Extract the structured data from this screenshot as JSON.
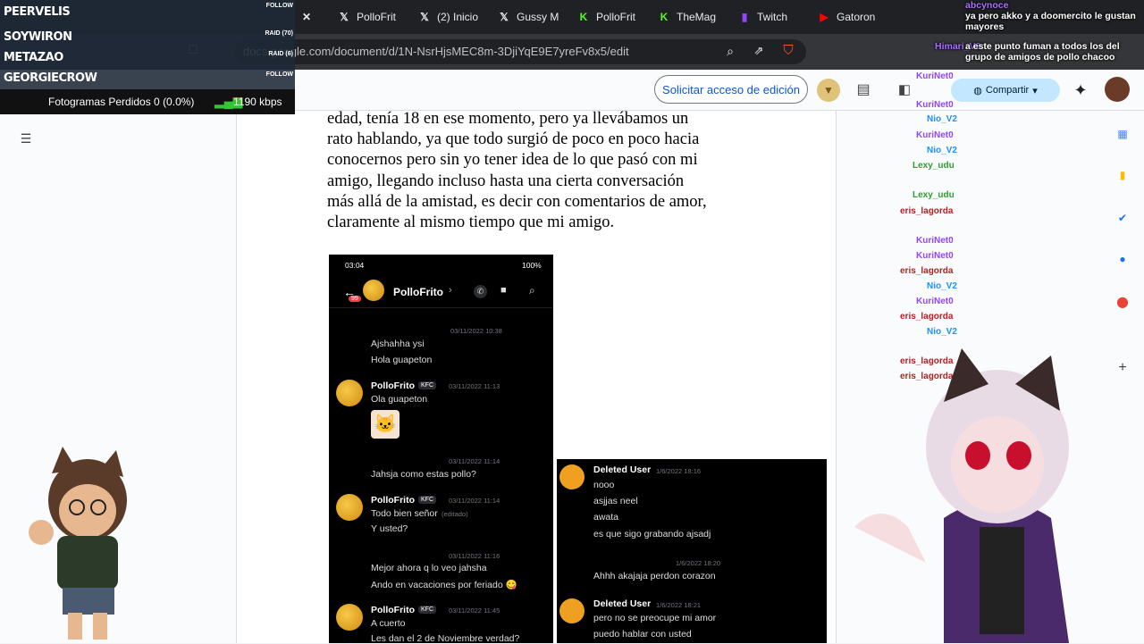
{
  "browser": {
    "tabs": [
      {
        "label": "",
        "icon": "close-icon"
      },
      {
        "label": "PolloFrit",
        "icon": "x-logo-icon"
      },
      {
        "label": "(2) Inicio",
        "icon": "x-logo-icon"
      },
      {
        "label": "Gussy M",
        "icon": "x-logo-icon"
      },
      {
        "label": "PolloFrit",
        "icon": "kick-logo-icon"
      },
      {
        "label": "TheMag",
        "icon": "kick-logo-icon"
      },
      {
        "label": "Twitch",
        "icon": "twitch-logo-icon"
      },
      {
        "label": "Gatoron",
        "icon": "youtube-logo-icon"
      }
    ],
    "url": "docs.google.com/document/d/1N-NsrHjsMEC8m-3DjiYqE9E7yreFv8x5/edit"
  },
  "docs": {
    "request_edit_label": "Solicitar acceso de edición",
    "share_label": "Compartir"
  },
  "document": {
    "paragraph_lines": [
      "edad, tenía 18 en ese momento, pero ya llevábamos un",
      "rato hablando, ya que todo surgió de poco en poco hacia",
      "conocernos pero sin yo tener idea de lo que pasó con mi",
      "amigo, llegando incluso hasta una cierta conversación",
      "más allá de la amistad, es decir con comentarios de amor,",
      "claramente al mismo tiempo que mi amigo."
    ]
  },
  "phone_screenshot": {
    "status_time": "03:04",
    "battery": "100%",
    "badge": "99",
    "contact": "PolloFrito",
    "messages": [
      {
        "ts": "03/11/2022 10:38",
        "lines": [
          "Ajshahha ysi",
          "Hola guapeton"
        ]
      },
      {
        "user": "PolloFrito",
        "tag": "KFC",
        "ts": "03/11/2022 11:13",
        "lines": [
          "Ola guapeton"
        ]
      },
      {
        "ts": "03/11/2022 11:14",
        "lines": [
          "Jahsja como estas pollo?"
        ]
      },
      {
        "user": "PolloFrito",
        "tag": "KFC",
        "ts": "03/11/2022 11:14",
        "lines": [
          "Todo bien señor",
          "Y usted?"
        ],
        "edited": "(editado)"
      },
      {
        "ts": "03/11/2022 11:16",
        "lines": [
          "Mejor ahora q lo veo jahsha",
          "Ando en vacaciones por feriado 😋"
        ]
      },
      {
        "user": "PolloFrito",
        "tag": "KFC",
        "ts": "03/11/2022 11:45",
        "lines": [
          "A cuerto",
          "Les dan el 2 de Noviembre verdad?"
        ]
      }
    ]
  },
  "discord_screenshot": {
    "messages": [
      {
        "user": "Deleted User",
        "ts": "1/6/2022 18:16",
        "lines": [
          "nooo",
          "asjjas neel",
          "awata",
          "es que sigo grabando ajsadj"
        ]
      },
      {
        "ts": "1/6/2022 18:20",
        "lines": [
          "Ahhh akajaja perdon corazon"
        ]
      },
      {
        "user": "Deleted User",
        "ts": "1/6/2022 18:21",
        "lines": [
          "pero no se preocupe mi amor",
          "puedo hablar con usted"
        ]
      }
    ]
  },
  "stream": {
    "events": [
      {
        "name": "PEERVELIS",
        "tag": "FOLLOW"
      },
      {
        "name": "SOYWIRON",
        "tag": "RAID (70)"
      },
      {
        "name": "METAZAO",
        "tag": "RAID (6)"
      },
      {
        "name": "GEORGIECROW",
        "tag": "FOLLOW"
      }
    ],
    "stats": "Fotogramas Perdidos 0 (0.0%)",
    "bitrate": "1190 kbps",
    "ticker": [
      "abcynoce",
      "ya pero akko y a doomercito le gustan mayores",
      "Himari_V3",
      "a este punto fuman a todos los del grupo de amigos de pollo chacoo"
    ],
    "chat": [
      {
        "name": "KuriNet0",
        "color": "#9146ff"
      },
      {
        "name": "KuriNet0",
        "color": "#9146ff"
      },
      {
        "name": "Nio_V2",
        "color": "#1e90ff"
      },
      {
        "name": "KuriNet0",
        "color": "#9146ff",
        "msg": "?? ?? ?? ?? ?? ??"
      },
      {
        "name": "Nio_V2",
        "color": "#1e90ff"
      },
      {
        "name": "Lexy_udu",
        "color": "#2e9e2e"
      },
      {
        "name": "Lexy_udu",
        "color": "#2e9e2e"
      },
      {
        "name": "eris_lagorda",
        "color": "#b22222"
      },
      {
        "name": "KuriNet0",
        "color": "#9146ff"
      },
      {
        "name": "KuriNet0",
        "color": "#9146ff"
      },
      {
        "name": "eris_lagorda",
        "color": "#b22222"
      },
      {
        "name": "Nio_V2",
        "color": "#1e90ff"
      },
      {
        "name": "KuriNet0",
        "color": "#9146ff"
      },
      {
        "name": "eris_lagorda",
        "color": "#b22222"
      },
      {
        "name": "Nio_V2",
        "color": "#1e90ff"
      },
      {
        "name": "eris_lagorda",
        "color": "#b22222"
      },
      {
        "name": "eris_lagorda",
        "color": "#b22222"
      }
    ]
  }
}
